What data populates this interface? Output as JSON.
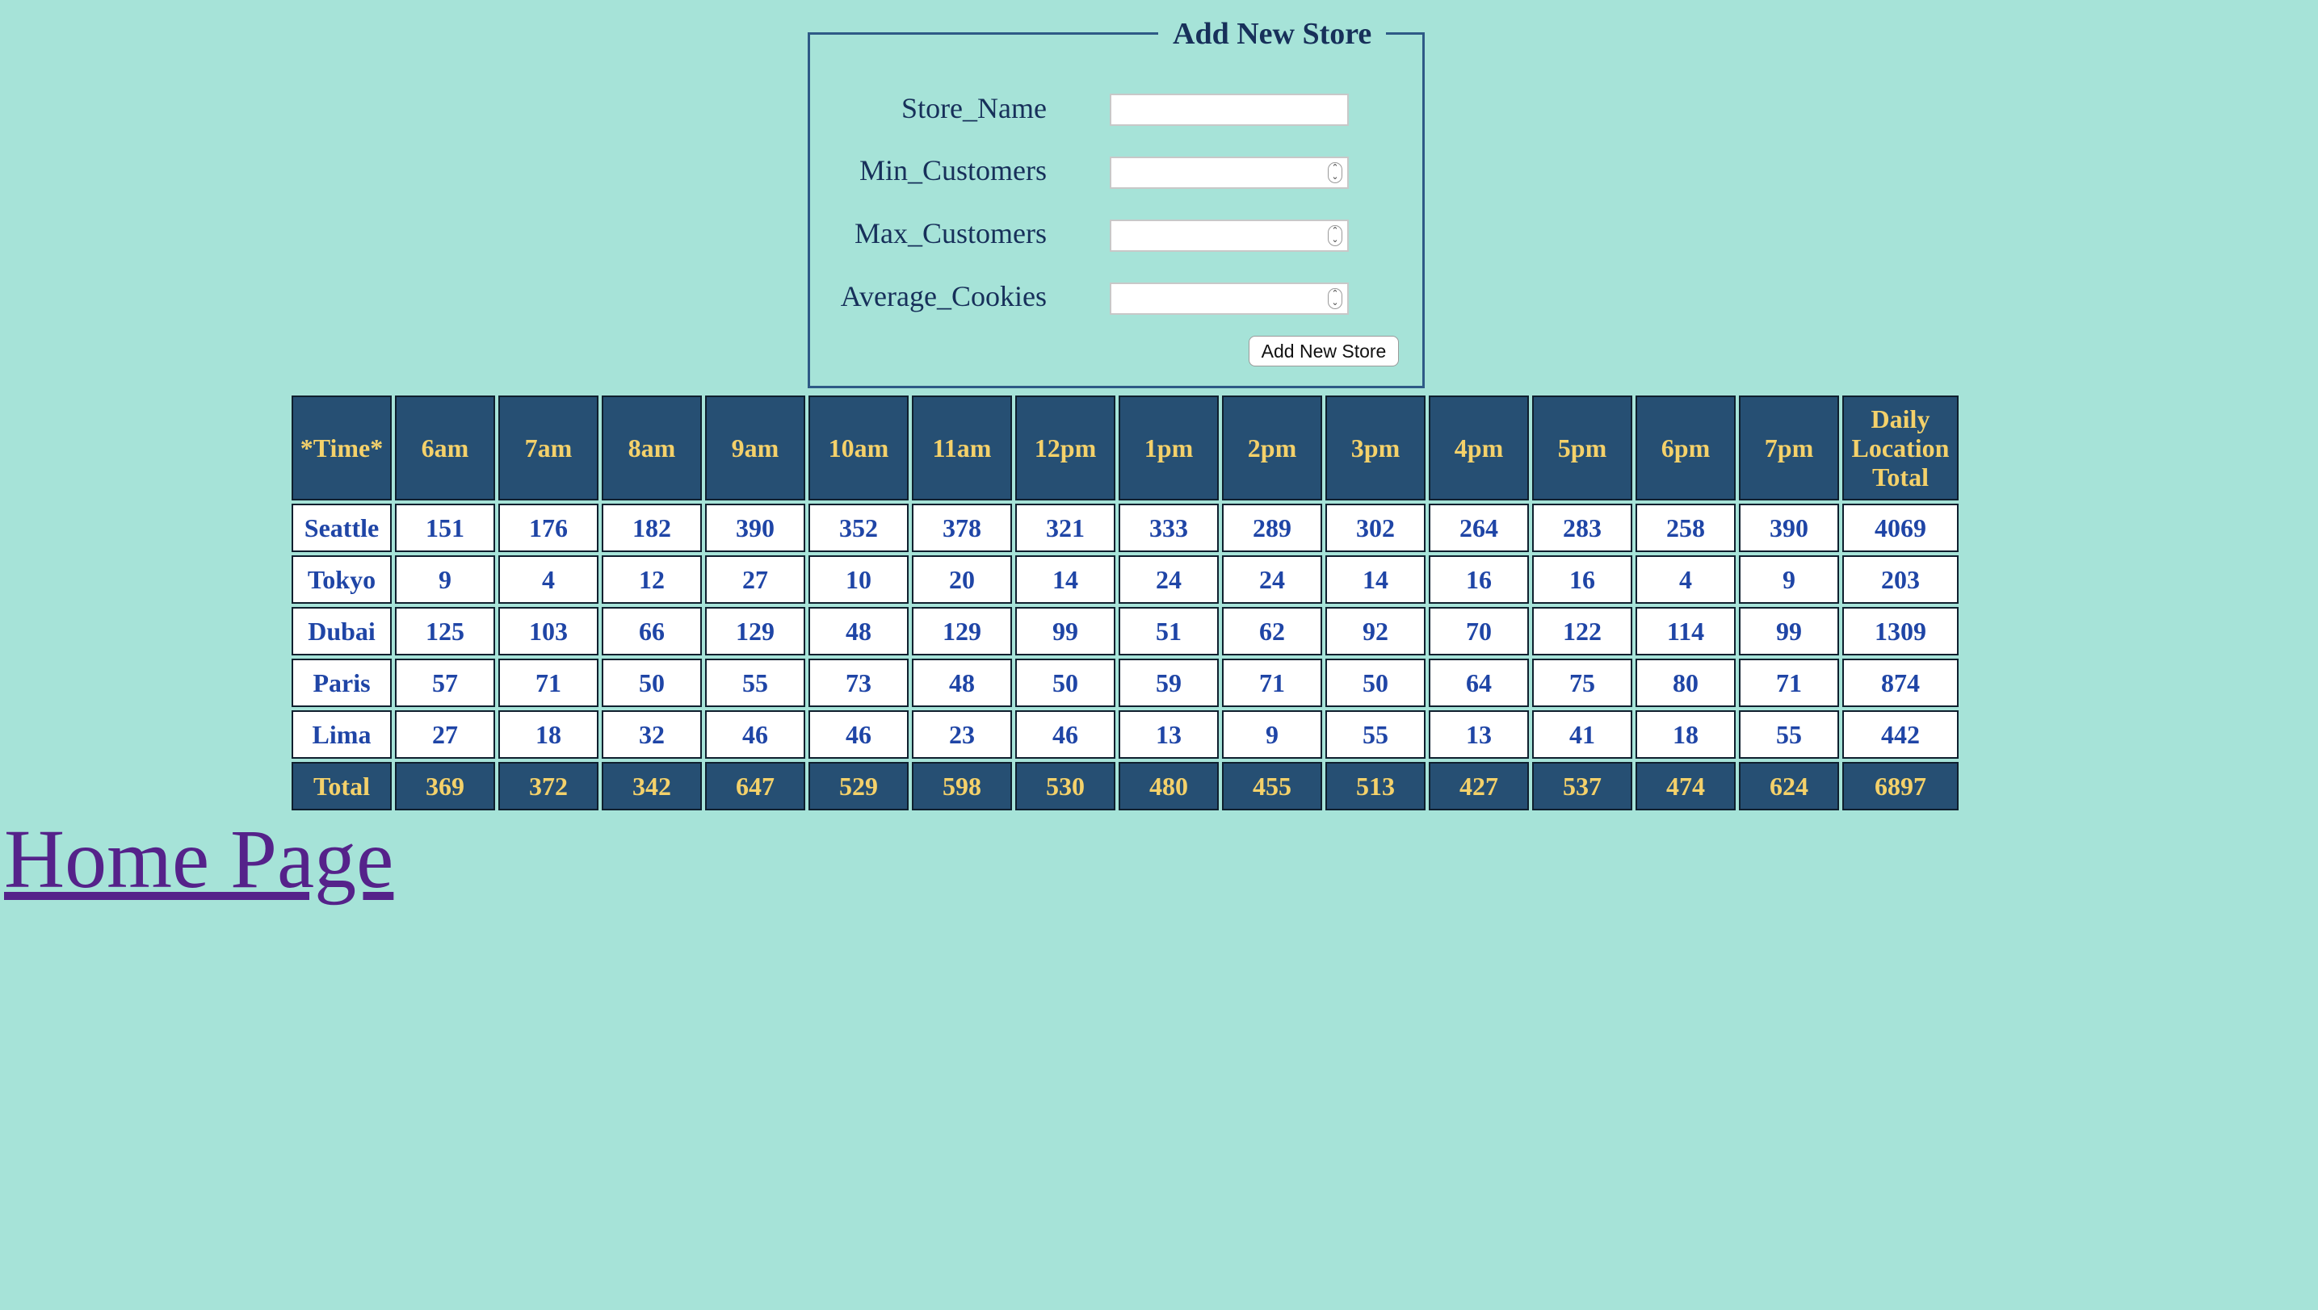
{
  "form": {
    "legend": "Add New Store",
    "fields": [
      {
        "label": "Store_Name",
        "value": ""
      },
      {
        "label": "Min_Customers",
        "value": ""
      },
      {
        "label": "Max_Customers",
        "value": ""
      },
      {
        "label": "Average_Cookies",
        "value": ""
      }
    ],
    "submit_label": "Add New Store"
  },
  "table": {
    "headers": [
      "*Time*",
      "6am",
      "7am",
      "8am",
      "9am",
      "10am",
      "11am",
      "12pm",
      "1pm",
      "2pm",
      "3pm",
      "4pm",
      "5pm",
      "6pm",
      "7pm",
      "Daily Location Total"
    ],
    "rows": [
      [
        "Seattle",
        "151",
        "176",
        "182",
        "390",
        "352",
        "378",
        "321",
        "333",
        "289",
        "302",
        "264",
        "283",
        "258",
        "390",
        "4069"
      ],
      [
        "Tokyo",
        "9",
        "4",
        "12",
        "27",
        "10",
        "20",
        "14",
        "24",
        "24",
        "14",
        "16",
        "16",
        "4",
        "9",
        "203"
      ],
      [
        "Dubai",
        "125",
        "103",
        "66",
        "129",
        "48",
        "129",
        "99",
        "51",
        "62",
        "92",
        "70",
        "122",
        "114",
        "99",
        "1309"
      ],
      [
        "Paris",
        "57",
        "71",
        "50",
        "55",
        "73",
        "48",
        "50",
        "59",
        "71",
        "50",
        "64",
        "75",
        "80",
        "71",
        "874"
      ],
      [
        "Lima",
        "27",
        "18",
        "32",
        "46",
        "46",
        "23",
        "46",
        "13",
        "9",
        "55",
        "13",
        "41",
        "18",
        "55",
        "442"
      ]
    ],
    "totals": [
      "Total",
      "369",
      "372",
      "342",
      "647",
      "529",
      "598",
      "530",
      "480",
      "455",
      "513",
      "427",
      "537",
      "474",
      "624",
      "6897"
    ]
  },
  "home_link": "Home Page"
}
